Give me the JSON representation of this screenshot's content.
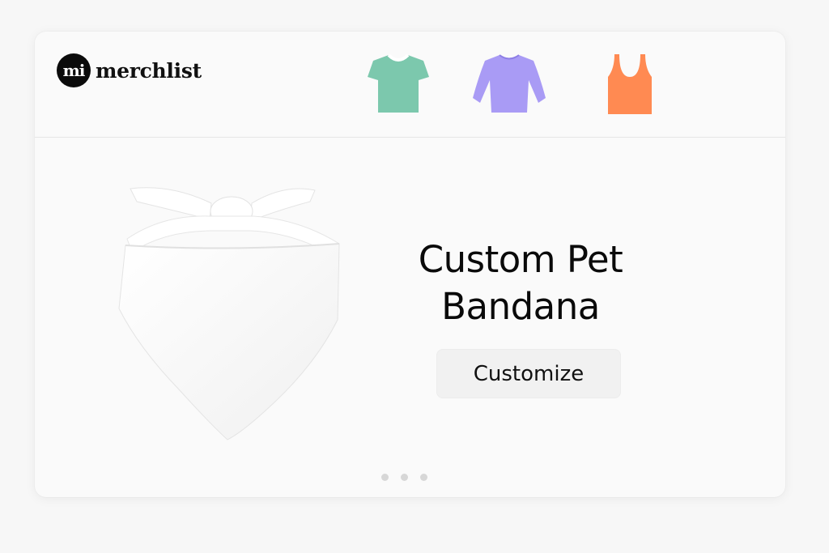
{
  "brand": {
    "logo_mark": "mi",
    "name": "merchlist"
  },
  "categories": [
    {
      "name": "tshirt-icon",
      "color": "#7cc8ad"
    },
    {
      "name": "longsleeve-icon",
      "color": "#a99bf5"
    },
    {
      "name": "tank-top-icon",
      "color": "#ff8a52"
    }
  ],
  "product": {
    "title_line1": "Custom Pet",
    "title_line2": "Bandana",
    "image_icon": "bandana-icon"
  },
  "cta": {
    "label": "Customize"
  },
  "carousel": {
    "slide_count": 3
  },
  "colors": {
    "background": "#f7f7f7",
    "card": "#fafafa",
    "button": "#f1f1f1",
    "text": "#0a0a0a"
  }
}
